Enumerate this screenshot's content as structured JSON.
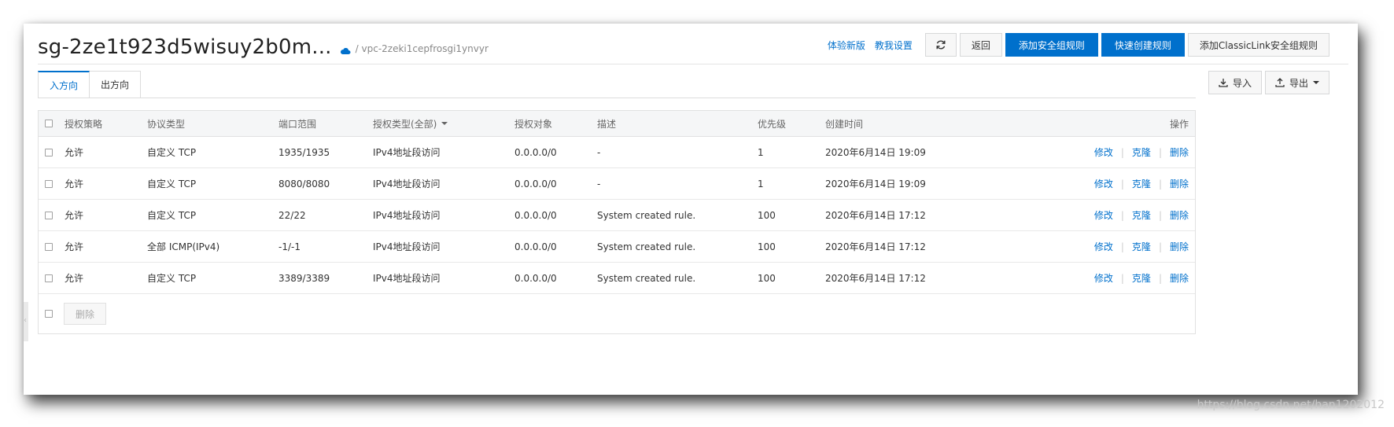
{
  "header": {
    "title": "sg-2ze1t923d5wisuy2b0m...",
    "vpc": "/ vpc-2zeki1cepfrosgi1ynvyr",
    "links": [
      "体验新版",
      "教我设置"
    ],
    "back_label": "返回",
    "add_rule_label": "添加安全组规则",
    "quick_create_label": "快速创建规则",
    "classiclink_label": "添加ClassicLink安全组规则"
  },
  "tabs": [
    {
      "label": "入方向",
      "active": true
    },
    {
      "label": "出方向",
      "active": false
    }
  ],
  "io": {
    "import_label": "导入",
    "export_label": "导出"
  },
  "table": {
    "columns": [
      "授权策略",
      "协议类型",
      "端口范围",
      "授权类型(全部)",
      "授权对象",
      "描述",
      "优先级",
      "创建时间",
      "操作"
    ],
    "rows": [
      {
        "policy": "允许",
        "protocol": "自定义 TCP",
        "port": "1935/1935",
        "auth_type": "IPv4地址段访问",
        "target": "0.0.0.0/0",
        "desc": "-",
        "priority": "1",
        "created": "2020年6月14日 19:09"
      },
      {
        "policy": "允许",
        "protocol": "自定义 TCP",
        "port": "8080/8080",
        "auth_type": "IPv4地址段访问",
        "target": "0.0.0.0/0",
        "desc": "-",
        "priority": "1",
        "created": "2020年6月14日 19:09"
      },
      {
        "policy": "允许",
        "protocol": "自定义 TCP",
        "port": "22/22",
        "auth_type": "IPv4地址段访问",
        "target": "0.0.0.0/0",
        "desc": "System created rule.",
        "priority": "100",
        "created": "2020年6月14日 17:12"
      },
      {
        "policy": "允许",
        "protocol": "全部 ICMP(IPv4)",
        "port": "-1/-1",
        "auth_type": "IPv4地址段访问",
        "target": "0.0.0.0/0",
        "desc": "System created rule.",
        "priority": "100",
        "created": "2020年6月14日 17:12"
      },
      {
        "policy": "允许",
        "protocol": "自定义 TCP",
        "port": "3389/3389",
        "auth_type": "IPv4地址段访问",
        "target": "0.0.0.0/0",
        "desc": "System created rule.",
        "priority": "100",
        "created": "2020年6月14日 17:12"
      }
    ],
    "ops": {
      "modify": "修改",
      "clone": "克隆",
      "delete": "删除",
      "sep": "|"
    },
    "footer_delete_label": "删除"
  },
  "watermark": "https://blog.csdn.net/han1202012",
  "colors": {
    "accent": "#0070cc",
    "border": "#e1e1e1",
    "header_bg": "#f5f6f7"
  }
}
